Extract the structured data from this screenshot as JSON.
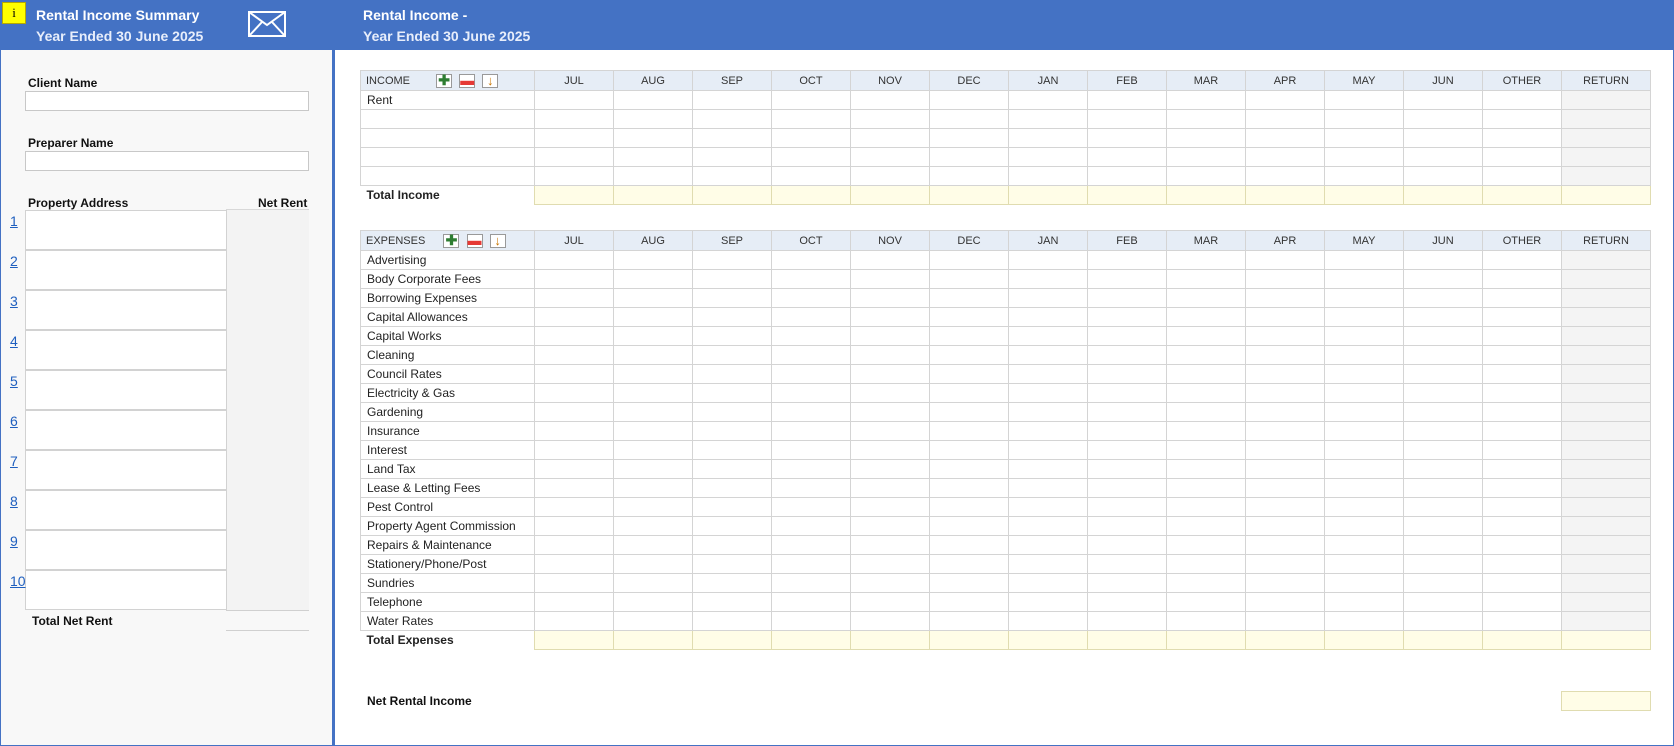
{
  "left_header": {
    "title_line1": "Rental Income Summary",
    "title_line2": "Year Ended 30 June 2025",
    "info_glyph": "i"
  },
  "right_header": {
    "title_line1": "Rental Income -",
    "title_line2": "Year Ended 30 June 2025"
  },
  "left_panel": {
    "client_name_label": "Client Name",
    "client_name_value": "",
    "preparer_name_label": "Preparer Name",
    "preparer_name_value": "",
    "property_address_label": "Property Address",
    "net_rent_label": "Net Rent",
    "property_numbers": [
      "1",
      "2",
      "3",
      "4",
      "5",
      "6",
      "7",
      "8",
      "9",
      "10"
    ],
    "total_net_rent_label": "Total Net Rent"
  },
  "months": [
    "JUL",
    "AUG",
    "SEP",
    "OCT",
    "NOV",
    "DEC",
    "JAN",
    "FEB",
    "MAR",
    "APR",
    "MAY",
    "JUN",
    "OTHER",
    "RETURN"
  ],
  "income": {
    "header": "INCOME",
    "rows": [
      "Rent",
      "",
      "",
      "",
      ""
    ],
    "total_label": "Total Income"
  },
  "expenses": {
    "header": "EXPENSES",
    "rows": [
      "Advertising",
      "Body Corporate Fees",
      "Borrowing Expenses",
      "Capital Allowances",
      "Capital Works",
      "Cleaning",
      "Council Rates",
      "Electricity & Gas",
      "Gardening",
      "Insurance",
      "Interest",
      "Land Tax",
      "Lease & Letting Fees",
      "Pest Control",
      "Property Agent Commission",
      "Repairs & Maintenance",
      "Stationery/Phone/Post",
      "Sundries",
      "Telephone",
      "Water Rates"
    ],
    "total_label": "Total Expenses"
  },
  "net_rental_income_label": "Net Rental Income",
  "toolbar": {
    "add_glyph": "✚",
    "remove_glyph": "▬",
    "down_glyph": "↓"
  },
  "icons": {
    "info": "info-icon",
    "mail": "envelope-icon",
    "add": "plus-icon",
    "remove": "minus-icon",
    "move_down": "arrow-down-icon"
  },
  "colors": {
    "header_blue": "#4472c4",
    "header_cell": "#e6edf6",
    "total_fill": "#fffde7",
    "link_blue": "#1f5fbf"
  }
}
